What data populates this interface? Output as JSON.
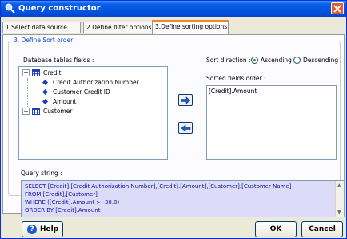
{
  "window": {
    "title": "Query constructor"
  },
  "tabs": [
    {
      "label": "1.Select data source"
    },
    {
      "label": "2.Define filter options"
    },
    {
      "label": "3.Define sorting options"
    }
  ],
  "sort_group": {
    "legend": "3. Define Sort order",
    "tables_label": "Database tables fields :",
    "tree": {
      "credit_label": "Credit",
      "credit_fields": [
        "Credit Authorization Number",
        "Customer Credit ID",
        "Amount"
      ],
      "customer_label": "Customer"
    },
    "sort_direction_label": "Sort direction :",
    "ascending_label": "Ascending",
    "descending_label": "Descending",
    "sort_direction_selected": "Ascending",
    "sorted_fields_label": "Sorted fields order :",
    "sorted_fields": [
      "[Credit].Amount"
    ]
  },
  "query": {
    "label": "Query string :",
    "lines": [
      "SELECT [Credit].[Credit Authorization Number],[Credit].[Amount],[Customer].[Customer Name]",
      "FROM [Credit],[Customer]",
      "WHERE ([Credit].Amount > -30.0)",
      "ORDER BY [Credit].Amount"
    ]
  },
  "buttons": {
    "help": "Help",
    "ok": "OK",
    "cancel": "Cancel"
  }
}
